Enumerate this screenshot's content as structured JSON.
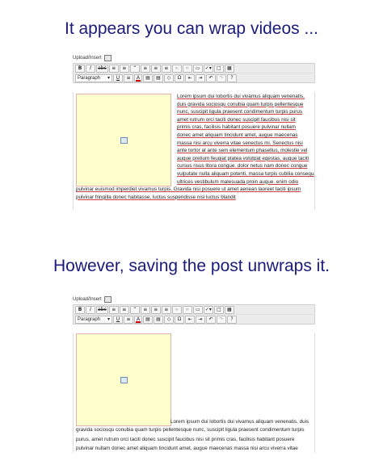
{
  "headings": {
    "top": "It appears you can wrap videos ...",
    "bottom": "However, saving the post unwraps it."
  },
  "editor": {
    "upload_label": "Upload/Insert",
    "format_select": "Paragraph",
    "icons": {
      "row1": [
        "bold-icon",
        "italic-icon",
        "strikethrough-icon",
        "bullet-list-icon",
        "numbered-list-icon",
        "blockquote-icon",
        "align-left-icon",
        "align-center-icon",
        "align-right-icon",
        "link-icon",
        "unlink-icon",
        "more-tag-icon",
        "spellcheck-icon",
        "fullscreen-icon",
        "kitchen-sink-icon"
      ],
      "row2": [
        "underline-icon",
        "justify-icon",
        "text-color-icon",
        "paste-text-icon",
        "paste-word-icon",
        "clear-format-icon",
        "special-char-icon",
        "outdent-icon",
        "indent-icon",
        "undo-icon",
        "redo-icon",
        "help-icon"
      ]
    },
    "colors": {
      "video_fill": "#ffffcc",
      "video_border": "#e4b0b0",
      "heading": "#1a1a7a"
    }
  },
  "editor1": {
    "wrapped_lines": [
      "Lorem ipsum dui lobortis dui vivamus aliquam venenatis,",
      "duis gravida sociosqu conubia quam turpis pellentesque",
      "nunc, suscipit ligula praesent condimentum turpis purus",
      "amet rutrum orci taciti donec suscipit faucibus nisi sit",
      "primis cras, facilisis habitant posuere pulvinar nullam",
      "donec amet aliquam tincidunt amet, augue maecenas",
      "massa nisi arcu viverra vitae senectus mi. Senectus nisi",
      "ante tortor at ante sem elementum phasellus, molestie vel",
      "augue pretium feugiat platea volutpat egestas, augue taciti",
      "cursus risus litora congue. dolor netus nam donec congue",
      "vulputate nulla aliquam potenti, massa turpis cubilia consequat",
      "ultrices vestibulum malesuada proin augue. enim odio"
    ],
    "full_lines": [
      "pulvinar euismod imperdiet vivamus turpis. Gravida nisi posuere ut amet aenean laoreet taciti ipsum",
      "pulvinar fringilla donec habitasse, luctus suspendisse nisi luctus blandit"
    ]
  },
  "editor2": {
    "after_video": "Lorem ipsum dui lobortis dui vivamus aliquam venenatis, duis",
    "full_lines": [
      "gravida sociosqu conubia quam turpis pellentesque nunc, suscipit ligula praesent condimentum turpis",
      "purus. amet rutrum orci taciti donec suscipit faucibus nisi sit primis cras, facilisis habitant posuere",
      "pulvinar nullam donec amet aliquam tincidunt amet, augue maecenas massa nisi arcu viverra vitae"
    ]
  }
}
